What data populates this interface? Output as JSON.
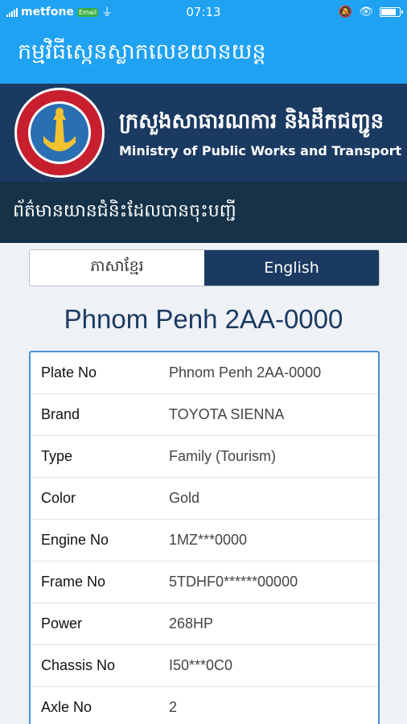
{
  "status_bar": {
    "carrier": "metfone",
    "badge": "Email",
    "time": "07:13",
    "battery_level": 0.85
  },
  "app_bar": {
    "title": "កម្មវិធីស្កេនស្លាកលេខយានយន្ត"
  },
  "ministry": {
    "name_kh": "ក្រសួងសាធារណការ និងដឹកជញ្ជូន",
    "name_en": "Ministry of Public Works and Transport"
  },
  "section": {
    "title": "ព័ត៌មានយានជំនិះដែលបានចុះបញ្ជី"
  },
  "language_toggle": {
    "options": [
      "ភាសាខ្មែរ",
      "English"
    ],
    "selected": "English"
  },
  "plate_title": "Phnom Penh 2AA-0000",
  "vehicle_info": [
    {
      "label": "Plate No",
      "value": "Phnom Penh 2AA-0000"
    },
    {
      "label": "Brand",
      "value": "TOYOTA SIENNA"
    },
    {
      "label": "Type",
      "value": "Family (Tourism)"
    },
    {
      "label": "Color",
      "value": "Gold"
    },
    {
      "label": "Engine No",
      "value": "1MZ***0000"
    },
    {
      "label": "Frame No",
      "value": "5TDHF0******00000"
    },
    {
      "label": "Power",
      "value": "268HP"
    },
    {
      "label": "Chassis No",
      "value": "I50***0C0"
    },
    {
      "label": "Axle No",
      "value": "2"
    }
  ],
  "colors": {
    "app_bar": "#1fa2f2",
    "banner": "#1b3a61",
    "section_header": "#163248",
    "accent": "#4a90d9"
  },
  "icons": [
    "signal-icon",
    "usb-icon",
    "mute-icon",
    "eye-icon",
    "battery-icon",
    "ministry-seal"
  ]
}
